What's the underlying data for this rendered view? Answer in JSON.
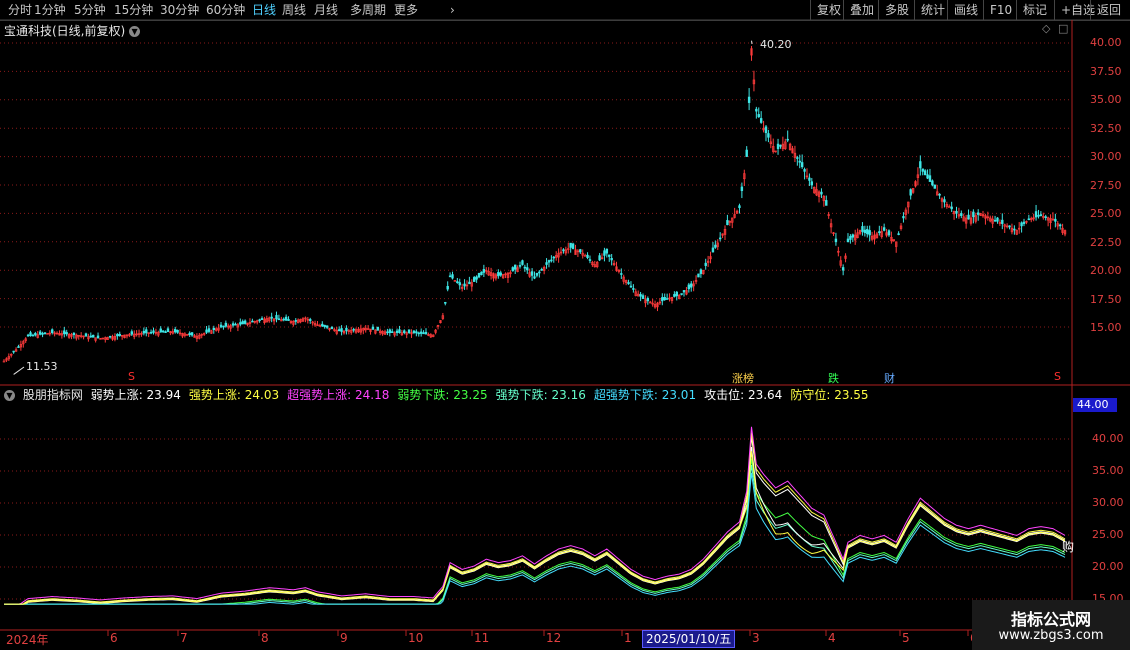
{
  "toolbar": {
    "periods": [
      "分时",
      "1分钟",
      "5分钟",
      "15分钟",
      "30分钟",
      "60分钟",
      "日线",
      "周线",
      "月线",
      "多周期",
      "更多"
    ],
    "active_period": "日线",
    "right_buttons": [
      "复权",
      "叠加",
      "多股",
      "统计",
      "画线",
      "F10",
      "标记",
      "+自选",
      "返回"
    ]
  },
  "main_chart": {
    "title": "宝通科技(日线,前复权)",
    "y_ticks": [
      "40.00",
      "37.50",
      "35.00",
      "32.50",
      "30.00",
      "27.50",
      "25.00",
      "22.50",
      "20.00",
      "17.50",
      "15.00"
    ],
    "high_label": "40.20",
    "low_label": "11.53",
    "markers": [
      {
        "text": "S",
        "color": "#ff3030"
      },
      {
        "text": "涨榜",
        "color": "#ffd24d"
      },
      {
        "text": "跌",
        "color": "#33ff55"
      },
      {
        "text": "财",
        "color": "#66aaff"
      },
      {
        "text": "S",
        "color": "#ff3030"
      }
    ]
  },
  "indicator": {
    "name": "股朋指标网",
    "lines": [
      {
        "label": "弱势上涨",
        "value": "23.94",
        "color": "#ffffff"
      },
      {
        "label": "强势上涨",
        "value": "24.03",
        "color": "#ffff44"
      },
      {
        "label": "超强势上涨",
        "value": "24.18",
        "color": "#ff44ff"
      },
      {
        "label": "弱势下跌",
        "value": "23.25",
        "color": "#44ff44"
      },
      {
        "label": "强势下跌",
        "value": "23.16",
        "color": "#66ffcc"
      },
      {
        "label": "超强势下跌",
        "value": "23.01",
        "color": "#44ddff"
      },
      {
        "label": "攻击位",
        "value": "23.64",
        "color": "#ffffff"
      },
      {
        "label": "防守位",
        "value": "23.55",
        "color": "#ffff44"
      }
    ],
    "y_ticks": [
      "40.00",
      "35.00",
      "30.00",
      "25.00",
      "20.00",
      "15.00"
    ],
    "current_tag": "44.00",
    "end_label": "购"
  },
  "dates": {
    "labels": [
      "2024年",
      "6",
      "7",
      "8",
      "9",
      "10",
      "11",
      "12",
      "1",
      "2",
      "3",
      "4",
      "5",
      "6"
    ],
    "selected": "2025/01/10/五"
  },
  "watermark": {
    "title": "指标公式网",
    "url": "www.zbgs3.com"
  },
  "chart_data": {
    "type": "candlestick",
    "title": "宝通科技(日线,前复权)",
    "ylim": [
      11,
      41
    ],
    "high": 40.2,
    "low": 11.53,
    "x": [
      "2024年",
      "6",
      "7",
      "8",
      "9",
      "10",
      "11",
      "12",
      "1",
      "2",
      "3",
      "4",
      "5",
      "6"
    ],
    "close_path": [
      [
        0,
        12.0
      ],
      [
        5,
        13.0
      ],
      [
        10,
        14.2
      ],
      [
        20,
        14.5
      ],
      [
        30,
        14.3
      ],
      [
        40,
        14.0
      ],
      [
        50,
        14.3
      ],
      [
        60,
        14.5
      ],
      [
        70,
        14.6
      ],
      [
        80,
        14.2
      ],
      [
        90,
        15.0
      ],
      [
        100,
        15.3
      ],
      [
        110,
        15.8
      ],
      [
        120,
        15.5
      ],
      [
        125,
        15.8
      ],
      [
        130,
        15.2
      ],
      [
        140,
        14.6
      ],
      [
        150,
        14.9
      ],
      [
        160,
        14.5
      ],
      [
        170,
        14.5
      ],
      [
        178,
        14.3
      ],
      [
        182,
        16.0
      ],
      [
        185,
        19.5
      ],
      [
        190,
        18.5
      ],
      [
        195,
        19.0
      ],
      [
        200,
        20.0
      ],
      [
        205,
        19.5
      ],
      [
        210,
        19.8
      ],
      [
        215,
        20.5
      ],
      [
        220,
        19.3
      ],
      [
        225,
        20.5
      ],
      [
        230,
        21.5
      ],
      [
        235,
        22.0
      ],
      [
        240,
        21.5
      ],
      [
        245,
        20.5
      ],
      [
        250,
        21.5
      ],
      [
        255,
        20.0
      ],
      [
        260,
        18.5
      ],
      [
        265,
        17.5
      ],
      [
        270,
        17.0
      ],
      [
        275,
        17.5
      ],
      [
        280,
        17.8
      ],
      [
        285,
        18.5
      ],
      [
        290,
        20.0
      ],
      [
        295,
        22.0
      ],
      [
        300,
        24.0
      ],
      [
        305,
        25.5
      ],
      [
        308,
        30.0
      ],
      [
        310,
        39.5
      ],
      [
        312,
        34.0
      ],
      [
        315,
        32.5
      ],
      [
        320,
        30.5
      ],
      [
        325,
        31.5
      ],
      [
        330,
        29.5
      ],
      [
        335,
        27.5
      ],
      [
        340,
        26.5
      ],
      [
        345,
        22.5
      ],
      [
        348,
        20.0
      ],
      [
        350,
        22.5
      ],
      [
        355,
        23.5
      ],
      [
        360,
        23.0
      ],
      [
        365,
        23.5
      ],
      [
        370,
        22.5
      ],
      [
        375,
        26.0
      ],
      [
        380,
        29.0
      ],
      [
        385,
        27.5
      ],
      [
        390,
        26.0
      ],
      [
        395,
        25.0
      ],
      [
        400,
        24.5
      ],
      [
        405,
        25.0
      ],
      [
        410,
        24.5
      ],
      [
        415,
        24.0
      ],
      [
        420,
        23.5
      ],
      [
        425,
        24.5
      ],
      [
        430,
        24.8
      ],
      [
        435,
        24.5
      ],
      [
        440,
        23.5
      ]
    ],
    "indicator_series": [
      "弱势上涨",
      "强势上涨",
      "超强势上涨",
      "弱势下跌",
      "强势下跌",
      "超强势下跌",
      "攻击位",
      "防守位"
    ]
  }
}
